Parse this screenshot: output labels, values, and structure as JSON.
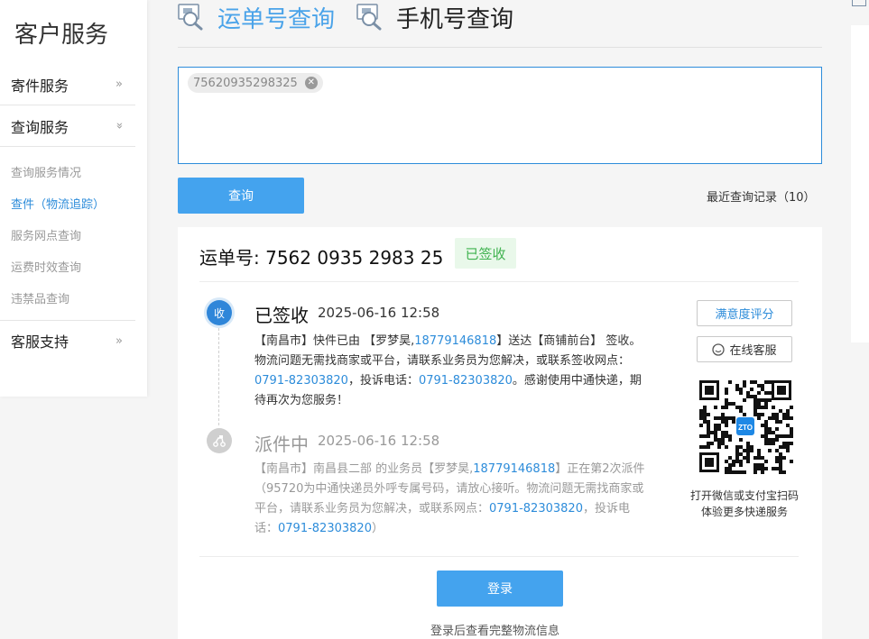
{
  "sidebar": {
    "title": "客户服务",
    "groups": [
      {
        "label": "寄件服务",
        "arrow": "»"
      },
      {
        "label": "查询服务",
        "arrow": "»"
      },
      {
        "label": "客服支持",
        "arrow": "»"
      }
    ],
    "sub_items": [
      {
        "label": "查询服务情况"
      },
      {
        "label": "查件（物流追踪）"
      },
      {
        "label": "服务网点查询"
      },
      {
        "label": "运费时效查询"
      },
      {
        "label": "违禁品查询"
      }
    ]
  },
  "tabs": [
    {
      "label": "运单号查询",
      "icon": "waybill-search-icon",
      "active": true
    },
    {
      "label": "手机号查询",
      "icon": "phone-search-icon",
      "active": false
    }
  ],
  "search": {
    "chip_value": "75620935298325",
    "query_button": "查询",
    "recent_label": "最近查询记录（10）"
  },
  "result": {
    "waybill_label": "运单号: 7562 0935 2983 25",
    "status_badge": "已签收",
    "events": [
      {
        "icon": "收",
        "status": "已签收",
        "time": "2025-06-16 12:58",
        "desc": {
          "p1": "【南昌市】快件已由 【罗梦昊,",
          "phone": "18779146818",
          "p2": "】送达【商铺前台】 签收。 物流问题无需找商家或平台，请联系业务员为您解决，或联系签收网点：",
          "tel1": "0791-82303820",
          "p3": "，投诉电话：",
          "tel2": "0791-82303820",
          "p4": "。感谢使用中通快递，期待再次为您服务！"
        }
      },
      {
        "icon": "delivery-scooter-icon",
        "status": "派件中",
        "time": "2025-06-16 12:58",
        "desc": {
          "p1": "【南昌市】南昌县二部 的业务员【罗梦昊,",
          "phone": "18779146818",
          "p2": "】正在第2次派件（95720为中通快递员外呼专属号码，请放心接听。物流问题无需找商家或平台，请联系业务员为您解决，或联系网点：",
          "tel1": "0791-82303820",
          "p3": "，投诉电话：",
          "tel2": "0791-82303820",
          "p4": "）"
        }
      }
    ],
    "rating_button": "满意度评分",
    "online_service_button": "在线客服",
    "qr_caption_line1": "打开微信或支付宝扫码",
    "qr_caption_line2": "体验更多快递服务",
    "qr_logo_text": "ZTO",
    "login_button": "登录",
    "login_hint": "登录后查看完整物流信息"
  },
  "colors": {
    "accent": "#44a3ee",
    "link": "#2d8cda",
    "signed_green": "#3fb24f"
  }
}
